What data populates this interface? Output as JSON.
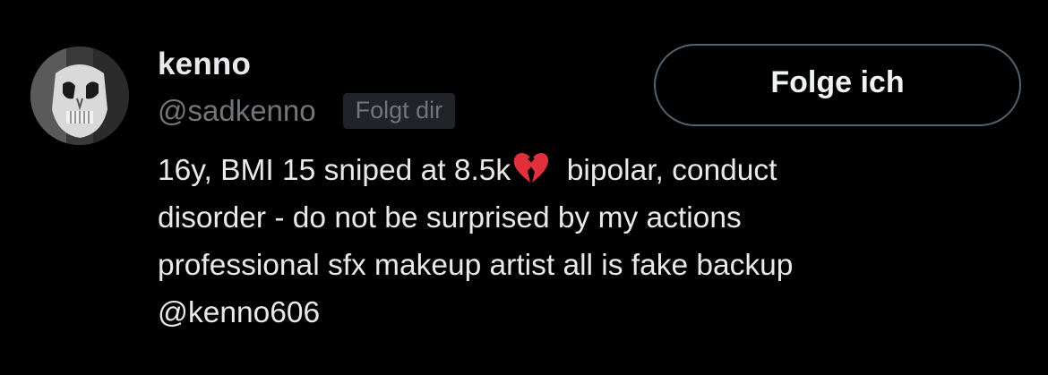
{
  "profile": {
    "name": "kenno",
    "handle": "@sadkenno",
    "follows_you_badge": "Folgt dir",
    "follow_button_label": "Folge ich",
    "bio": {
      "line1_before_emoji": "16y, BMI 15 sniped at 8.5k",
      "emoji": "broken-heart-icon",
      "line1_after_emoji": "bipolar, conduct",
      "line2": "disorder - do not be surprised by my actions",
      "line3": "professional sfx makeup artist all is fake backup",
      "line4": "@kenno606"
    }
  },
  "colors": {
    "background": "#000000",
    "primary_text": "#e7e9ea",
    "secondary_text": "#71767b",
    "badge_background": "#202327",
    "button_border": "#536471",
    "emoji_red": "#e0303c"
  }
}
